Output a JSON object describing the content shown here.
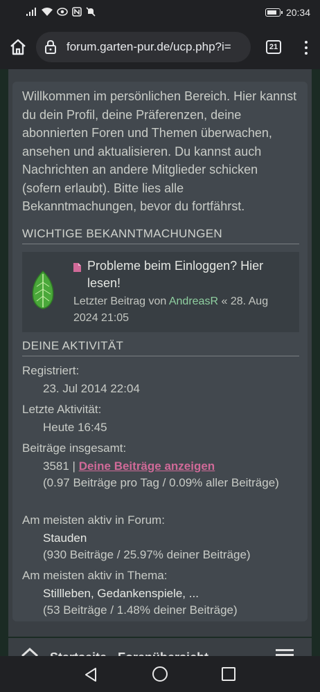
{
  "status_bar": {
    "time": "20:34",
    "icons": [
      "signal-icon",
      "wifi-icon",
      "eye-icon",
      "nfc-icon",
      "mute-icon"
    ],
    "battery_level": 0.9
  },
  "browser": {
    "url": "forum.garten-pur.de/ucp.php?i=",
    "tab_count": "21"
  },
  "intro_text": "Willkommen im persönlichen Bereich. Hier kannst du dein Profil, deine Präferenzen, deine abonnierten Foren und Themen überwachen, ansehen und aktualisieren. Du kannst auch Nachrichten an andere Mitglieder schicken (sofern erlaubt). Bitte lies alle Bekanntmachungen, bevor du fortfährst.",
  "announcements": {
    "heading": "WICHTIGE BEKANNTMACHUNGEN",
    "topic_title": "Probleme beim Einloggen? Hier lesen!",
    "last_post_prefix": "Letzter Beitrag von",
    "last_post_user": "AndreasR",
    "last_post_date": "« 28. Aug 2024 21:05"
  },
  "activity": {
    "heading": "DEINE AKTIVITÄT",
    "registered_label": "Registriert:",
    "registered_value": "23. Jul 2014 22:04",
    "last_active_label": "Letzte Aktivität:",
    "last_active_value": "Heute 16:45",
    "posts_label": "Beiträge insgesamt:",
    "posts_count": "3581 | ",
    "posts_link": "Deine Beiträge anzeigen",
    "posts_stats": "(0.97 Beiträge pro Tag / 0.09% aller Beiträge)",
    "forum_label": "Am meisten aktiv in Forum:",
    "forum_name": "Stauden",
    "forum_stats": "(930 Beiträge / 25.97% deiner Beiträge)",
    "topic_label": "Am meisten aktiv in Thema:",
    "topic_name": "Stillleben, Gedankenspiele, ...",
    "topic_stats": "(53 Beiträge / 1.48% deiner Beiträge)"
  },
  "footer": {
    "text": "Startseite · Forenübersicht"
  },
  "colors": {
    "accent_link": "#d06a98",
    "username": "#8fcfa0",
    "panel": "#42484e",
    "background": "#1b2b24"
  }
}
